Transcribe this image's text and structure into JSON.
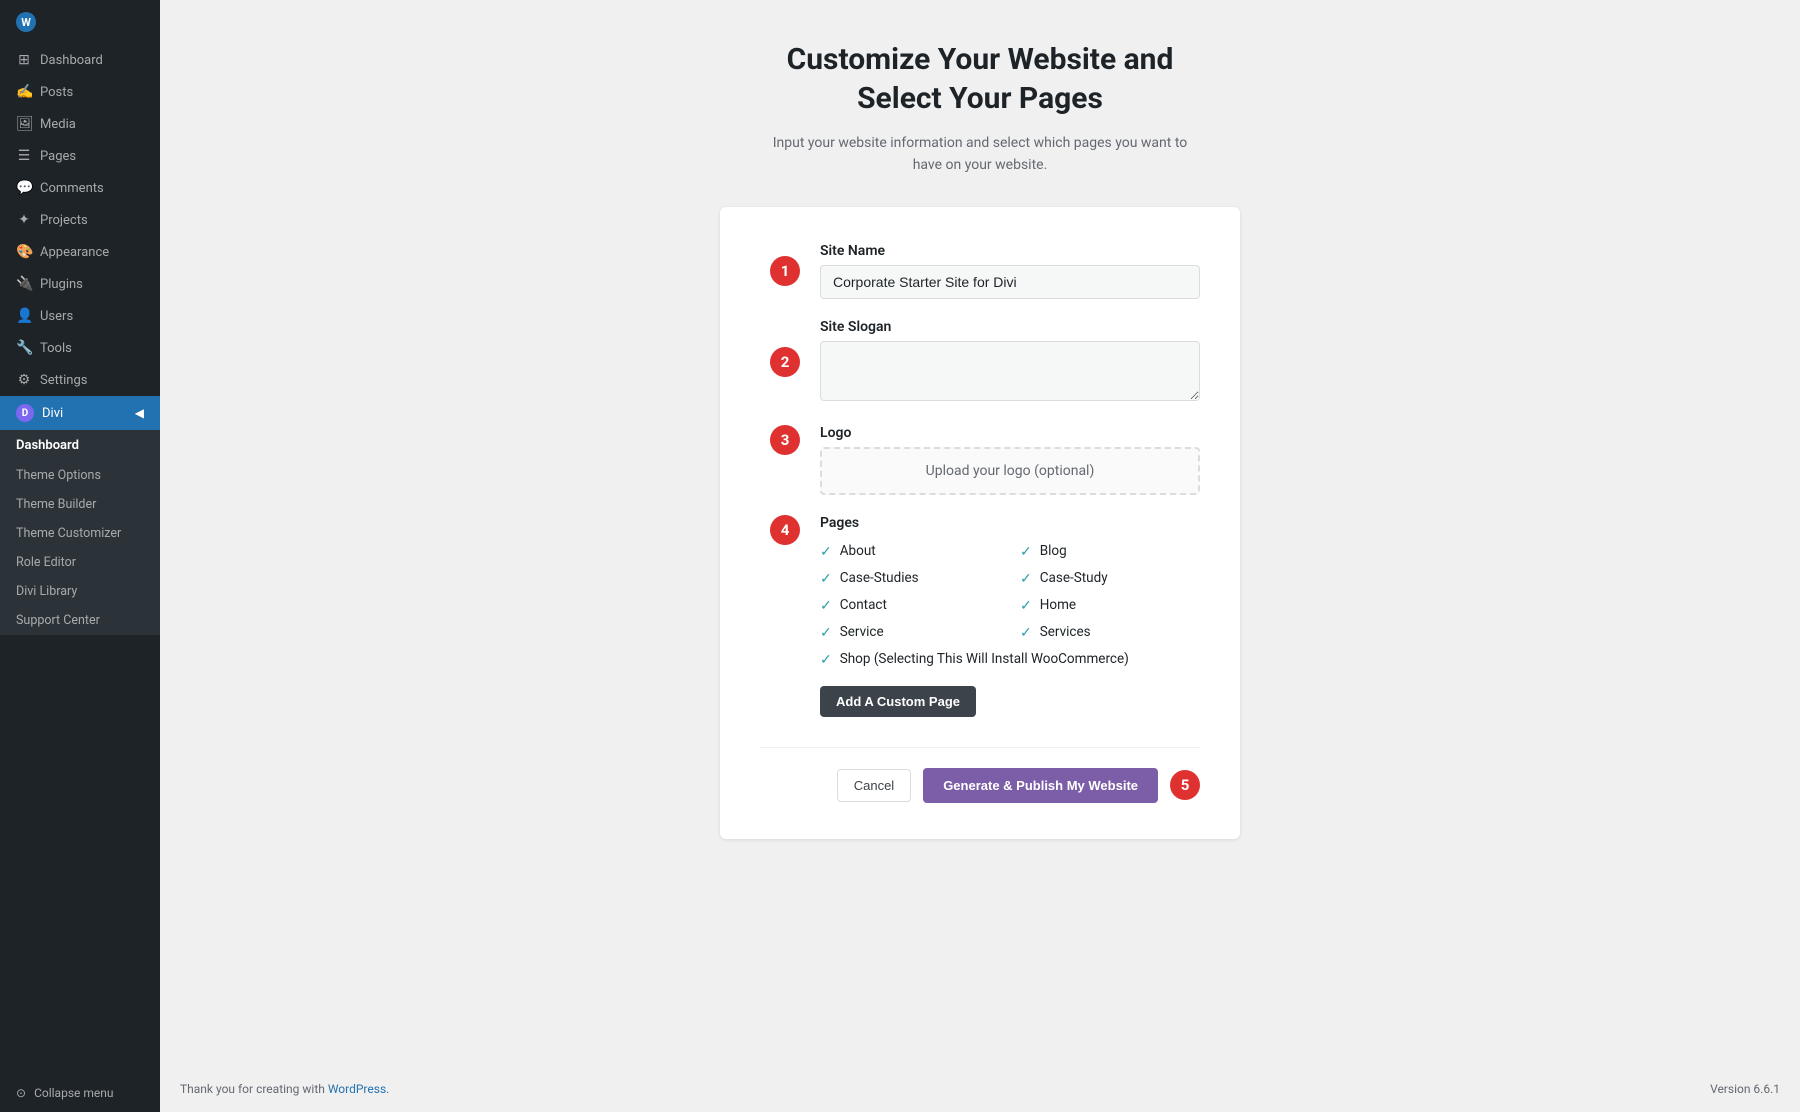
{
  "sidebar": {
    "wp_icon": "W",
    "nav_items": [
      {
        "id": "dashboard",
        "label": "Dashboard",
        "icon": "⊞"
      },
      {
        "id": "posts",
        "label": "Posts",
        "icon": "✍"
      },
      {
        "id": "media",
        "label": "Media",
        "icon": "⬜"
      },
      {
        "id": "pages",
        "label": "Pages",
        "icon": "☰"
      },
      {
        "id": "comments",
        "label": "Comments",
        "icon": "💬"
      },
      {
        "id": "projects",
        "label": "Projects",
        "icon": "⚙"
      }
    ],
    "appearance_label": "Appearance",
    "appearance_icon": "🎨",
    "plugins_label": "Plugins",
    "plugins_icon": "🔌",
    "users_label": "Users",
    "users_icon": "👤",
    "tools_label": "Tools",
    "tools_icon": "🔧",
    "settings_label": "Settings",
    "settings_icon": "⚙",
    "divi_label": "Divi",
    "divi_icon": "D",
    "divi_subitems": [
      {
        "id": "dashboard-sub",
        "label": "Dashboard"
      },
      {
        "id": "theme-options",
        "label": "Theme Options"
      },
      {
        "id": "theme-builder",
        "label": "Theme Builder"
      },
      {
        "id": "theme-customizer",
        "label": "Theme Customizer"
      },
      {
        "id": "role-editor",
        "label": "Role Editor"
      },
      {
        "id": "divi-library",
        "label": "Divi Library"
      },
      {
        "id": "support-center",
        "label": "Support Center"
      }
    ],
    "collapse_label": "Collapse menu",
    "collapse_icon": "⊙"
  },
  "page": {
    "title": "Customize Your Website and\nSelect Your Pages",
    "subtitle": "Input your website information and select which pages you want to have on your website."
  },
  "form": {
    "site_name_label": "Site Name",
    "site_name_value": "Corporate Starter Site for Divi",
    "site_name_placeholder": "Corporate Starter Site for Divi",
    "site_slogan_label": "Site Slogan",
    "site_slogan_value": "",
    "site_slogan_placeholder": "",
    "logo_label": "Logo",
    "logo_upload_text": "Upload your logo (optional)",
    "pages_label": "Pages",
    "pages": [
      {
        "id": "about",
        "label": "About",
        "checked": true
      },
      {
        "id": "blog",
        "label": "Blog",
        "checked": true
      },
      {
        "id": "case-studies",
        "label": "Case-Studies",
        "checked": true
      },
      {
        "id": "case-study",
        "label": "Case-Study",
        "checked": true
      },
      {
        "id": "contact",
        "label": "Contact",
        "checked": true
      },
      {
        "id": "home",
        "label": "Home",
        "checked": true
      },
      {
        "id": "service",
        "label": "Service",
        "checked": true
      },
      {
        "id": "services",
        "label": "Services",
        "checked": true
      },
      {
        "id": "shop",
        "label": "Shop (Selecting This Will Install WooCommerce)",
        "checked": true,
        "wide": true
      }
    ],
    "add_custom_page_label": "Add A Custom Page",
    "cancel_label": "Cancel",
    "publish_label": "Generate & Publish My Website"
  },
  "steps": {
    "step1": "1",
    "step2": "2",
    "step3": "3",
    "step4": "4",
    "step5": "5"
  },
  "footer": {
    "thanks_text": "Thank you for creating with ",
    "wp_link_text": "WordPress",
    "wp_link_url": "#",
    "version": "Version 6.6.1"
  }
}
